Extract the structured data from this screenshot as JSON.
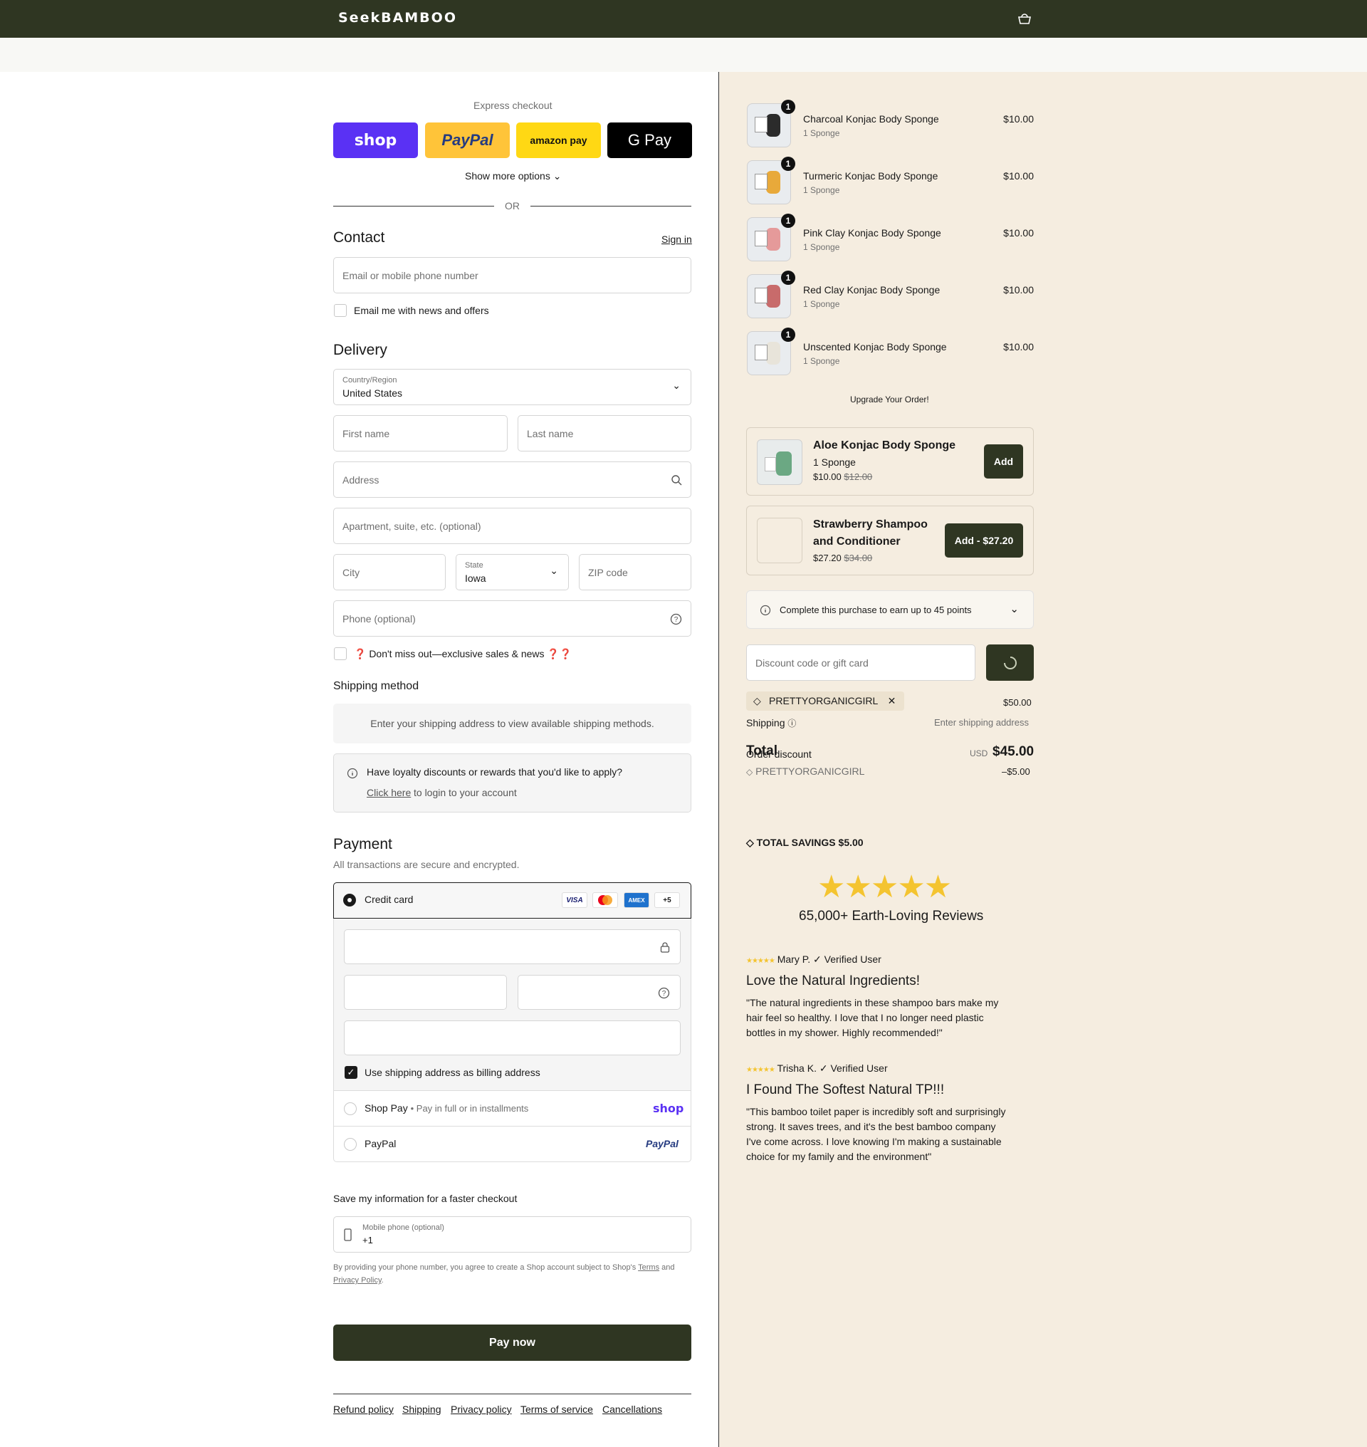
{
  "header": {
    "logo": "SeekBAMBOO",
    "cart_icon": "bag-icon",
    "brand_color": "#2f3622"
  },
  "express": {
    "title": "Express checkout",
    "buttons": [
      {
        "label": "shop",
        "color": "#5a31f4"
      },
      {
        "label": "PayPal",
        "color": "#ffc439"
      },
      {
        "label": "amazon pay",
        "color": "#ffd814"
      },
      {
        "label": "G Pay",
        "color": "#000000"
      }
    ],
    "more": "Show more options",
    "or": "OR"
  },
  "contact": {
    "title": "Contact",
    "sign_in": "Sign in",
    "email_placeholder": "Email or mobile phone number",
    "news_label": "Email me with news and offers"
  },
  "delivery": {
    "title": "Delivery",
    "country_label": "Country/Region",
    "country_value": "United States",
    "first_name": "First name",
    "last_name": "Last name",
    "address": "Address",
    "apartment": "Apartment, suite, etc. (optional)",
    "city": "City",
    "state_label": "State",
    "state_value": "Iowa",
    "zip": "ZIP code",
    "phone": "Phone (optional)",
    "sms_label": "❓ Don't miss out—exclusive sales & news ❓❓"
  },
  "shipping_method": {
    "title": "Shipping method",
    "notice": "Enter your shipping address to view available shipping methods."
  },
  "loyalty": {
    "text": "Have loyalty discounts or rewards that you'd like to apply?",
    "link": "Click here",
    "link_suffix": "to login to your account"
  },
  "payment": {
    "title": "Payment",
    "subtitle": "All transactions are secure and encrypted.",
    "credit_card": "Credit card",
    "card_brands": [
      "VISA",
      "",
      "AMEX",
      "+5"
    ],
    "billing_label": "Use shipping address as billing address",
    "shop_pay": "Shop Pay",
    "shop_pay_sub": "Pay in full or in installments",
    "shop_pay_logo": "shop",
    "paypal": "PayPal",
    "paypal_logo": "PayPal"
  },
  "save_info": {
    "title": "Save my information for a faster checkout",
    "mobile_label": "Mobile phone (optional)",
    "mobile_value": "+1",
    "legal_prefix": "By providing your phone number, you agree to create a Shop account subject to Shop's",
    "terms": "Terms",
    "and": "and",
    "privacy": "Privacy Policy",
    "period": "."
  },
  "pay_now": "Pay now",
  "footer_links": [
    "Refund policy",
    "Shipping",
    "Privacy policy",
    "Terms of service",
    "Cancellations"
  ],
  "order": {
    "items": [
      {
        "name": "Charcoal Konjac Body Sponge",
        "variant": "1 Sponge",
        "price": "$10.00",
        "qty": "1",
        "swatch": "#2b2b2b"
      },
      {
        "name": "Turmeric Konjac Body Sponge",
        "variant": "1 Sponge",
        "price": "$10.00",
        "qty": "1",
        "swatch": "#e8a93a"
      },
      {
        "name": "Pink Clay Konjac Body Sponge",
        "variant": "1 Sponge",
        "price": "$10.00",
        "qty": "1",
        "swatch": "#e59a9a"
      },
      {
        "name": "Red Clay Konjac Body Sponge",
        "variant": "1 Sponge",
        "price": "$10.00",
        "qty": "1",
        "swatch": "#c86b6b"
      },
      {
        "name": "Unscented Konjac Body Sponge",
        "variant": "1 Sponge",
        "price": "$10.00",
        "qty": "1",
        "swatch": "#e8e4da"
      }
    ],
    "upgrade_title": "Upgrade Your Order!",
    "upsells": [
      {
        "name": "Aloe Konjac Body Sponge",
        "variant": "1 Sponge",
        "price": "$10.00",
        "old_price": "$12.00",
        "button": "Add"
      },
      {
        "name": "Strawberry Shampoo and Conditioner",
        "price": "$27.20",
        "old_price": "$34.00",
        "button": "Add - $27.20"
      }
    ],
    "points": "Complete this purchase to earn up to 45 points",
    "discount_placeholder": "Discount code or gift card",
    "code": "PRETTYORGANICGIRL",
    "subtotal": "$50.00",
    "shipping_label": "Shipping",
    "shipping_value": "Enter shipping address",
    "total_label": "Total",
    "currency": "USD",
    "total": "$45.00",
    "order_discount": "Order discount",
    "discount_code": "PRETTYORGANICGIRL",
    "discount_amount": "–$5.00",
    "savings_label": "TOTAL SAVINGS",
    "savings_value": "$5.00"
  },
  "reviews": {
    "rating": 5,
    "headline": "65,000+ Earth-Loving Reviews",
    "items": [
      {
        "author": "Mary P. ✓ Verified User",
        "title": "Love the Natural Ingredients!",
        "body": "\"The natural ingredients in these shampoo bars make my hair feel so healthy. I love that I no longer need plastic bottles in my shower. Highly recommended!\""
      },
      {
        "author": "Trisha K. ✓ Verified User",
        "title": "I Found The Softest Natural TP!!!",
        "body": "\"This bamboo toilet paper is incredibly soft and surprisingly strong. It saves trees, and it's the best bamboo company I've come across. I love knowing I'm making a sustainable choice for my family and the environment\""
      }
    ]
  }
}
